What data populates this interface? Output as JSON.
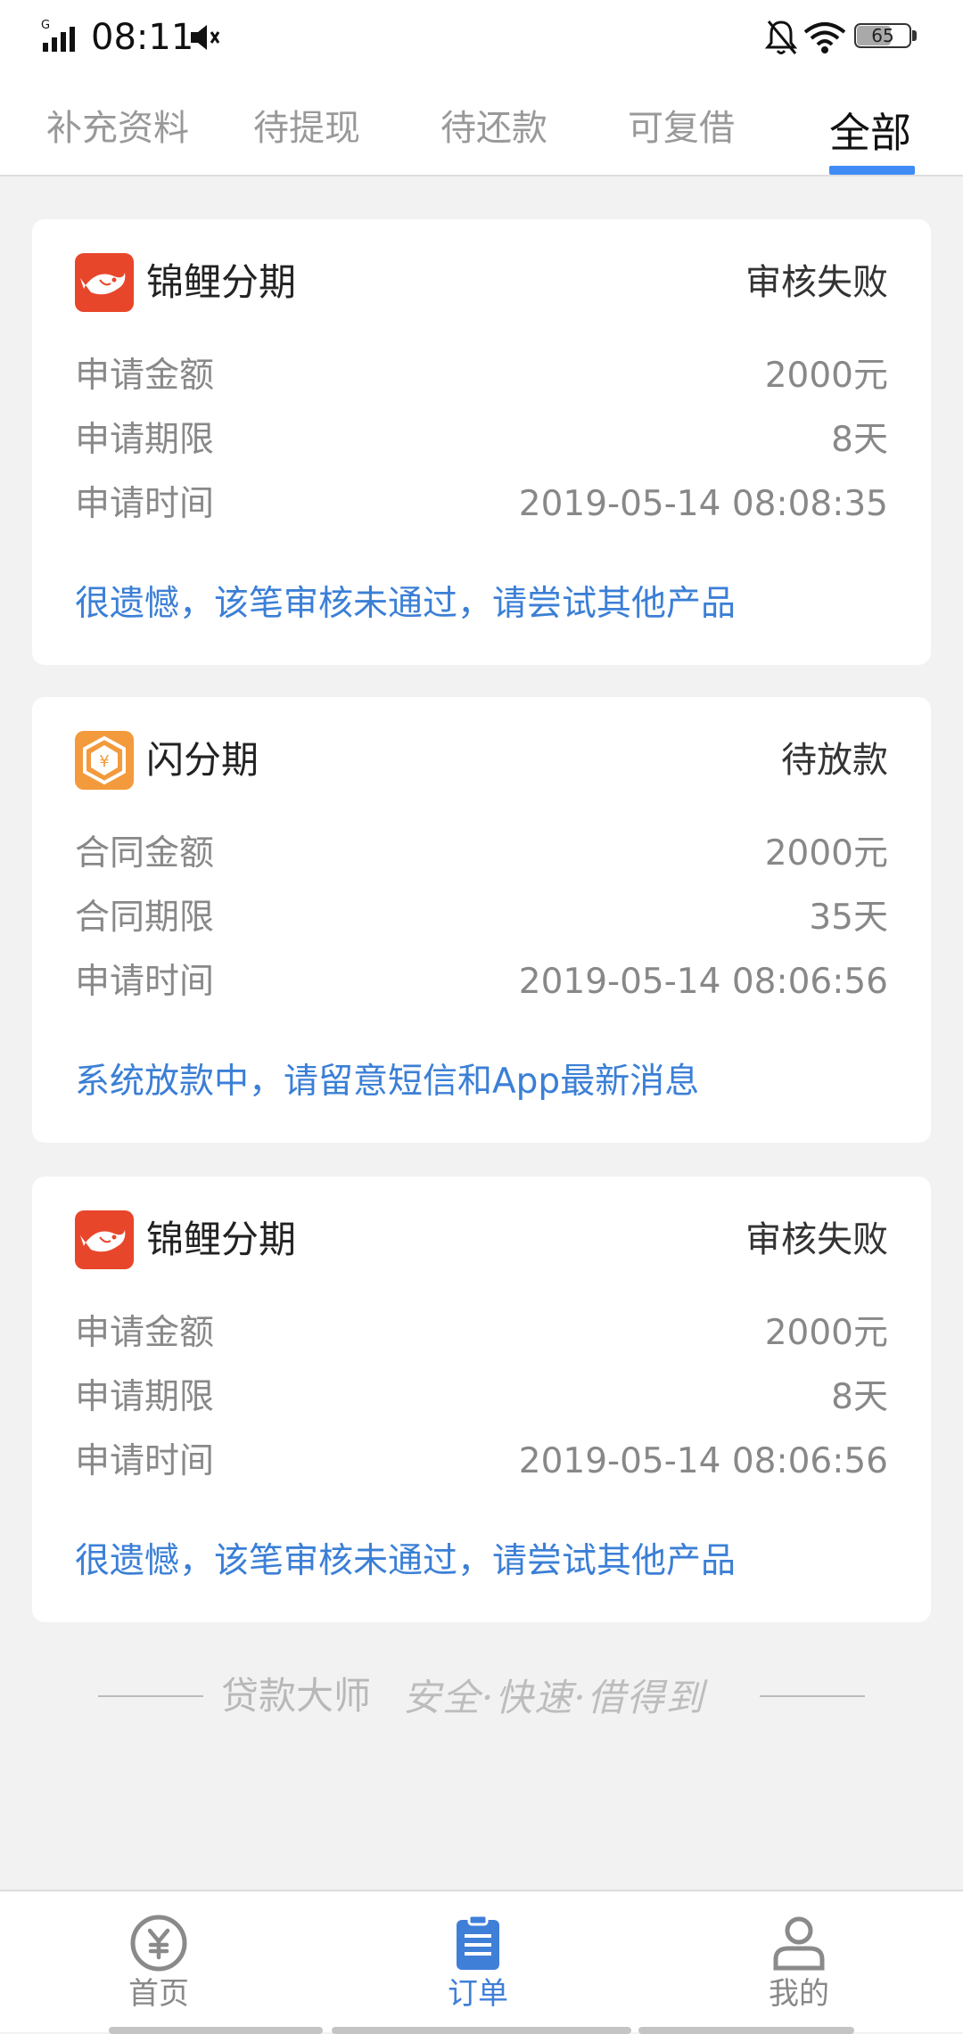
{
  "status_bar": {
    "network": "G",
    "time": "08:11",
    "battery": "65",
    "battery_level_percent": 65
  },
  "tabs": [
    {
      "label": "补充资料",
      "active": false
    },
    {
      "label": "待提现",
      "active": false
    },
    {
      "label": "待还款",
      "active": false
    },
    {
      "label": "可复借",
      "active": false
    },
    {
      "label": "全部",
      "active": true
    }
  ],
  "orders": [
    {
      "product": "锦鲤分期",
      "logo": "koi-fish-icon",
      "status": "审核失败",
      "rows": [
        {
          "label": "申请金额",
          "value": "2000元"
        },
        {
          "label": "申请期限",
          "value": "8天"
        },
        {
          "label": "申请时间",
          "value": "2019-05-14 08:08:35"
        }
      ],
      "note": "很遗憾，该笔审核未通过，请尝试其他产品"
    },
    {
      "product": "闪分期",
      "logo": "yuan-flash-icon",
      "status": "待放款",
      "rows": [
        {
          "label": "合同金额",
          "value": "2000元"
        },
        {
          "label": "合同期限",
          "value": "35天"
        },
        {
          "label": "申请时间",
          "value": "2019-05-14 08:06:56"
        }
      ],
      "note": "系统放款中，请留意短信和App最新消息"
    },
    {
      "product": "锦鲤分期",
      "logo": "koi-fish-icon",
      "status": "审核失败",
      "rows": [
        {
          "label": "申请金额",
          "value": "2000元"
        },
        {
          "label": "申请期限",
          "value": "8天"
        },
        {
          "label": "申请时间",
          "value": "2019-05-14 08:06:56"
        }
      ],
      "note": "很遗憾，该笔审核未通过，请尝试其他产品"
    }
  ],
  "footer": {
    "brand": "贷款大师",
    "tagline": "安全·快速·借得到"
  },
  "bottom_nav": [
    {
      "label": "首页",
      "icon": "yuan-coin-icon",
      "active": false
    },
    {
      "label": "订单",
      "icon": "clipboard-list-icon",
      "active": true
    },
    {
      "label": "我的",
      "icon": "user-icon",
      "active": false
    }
  ],
  "colors": {
    "accent": "#3f8cf5",
    "note_blue": "#3b7fd6",
    "koi_red": "#e8462a",
    "flash_orange": "#f39a3c",
    "page_bg": "#f2f2f2"
  }
}
